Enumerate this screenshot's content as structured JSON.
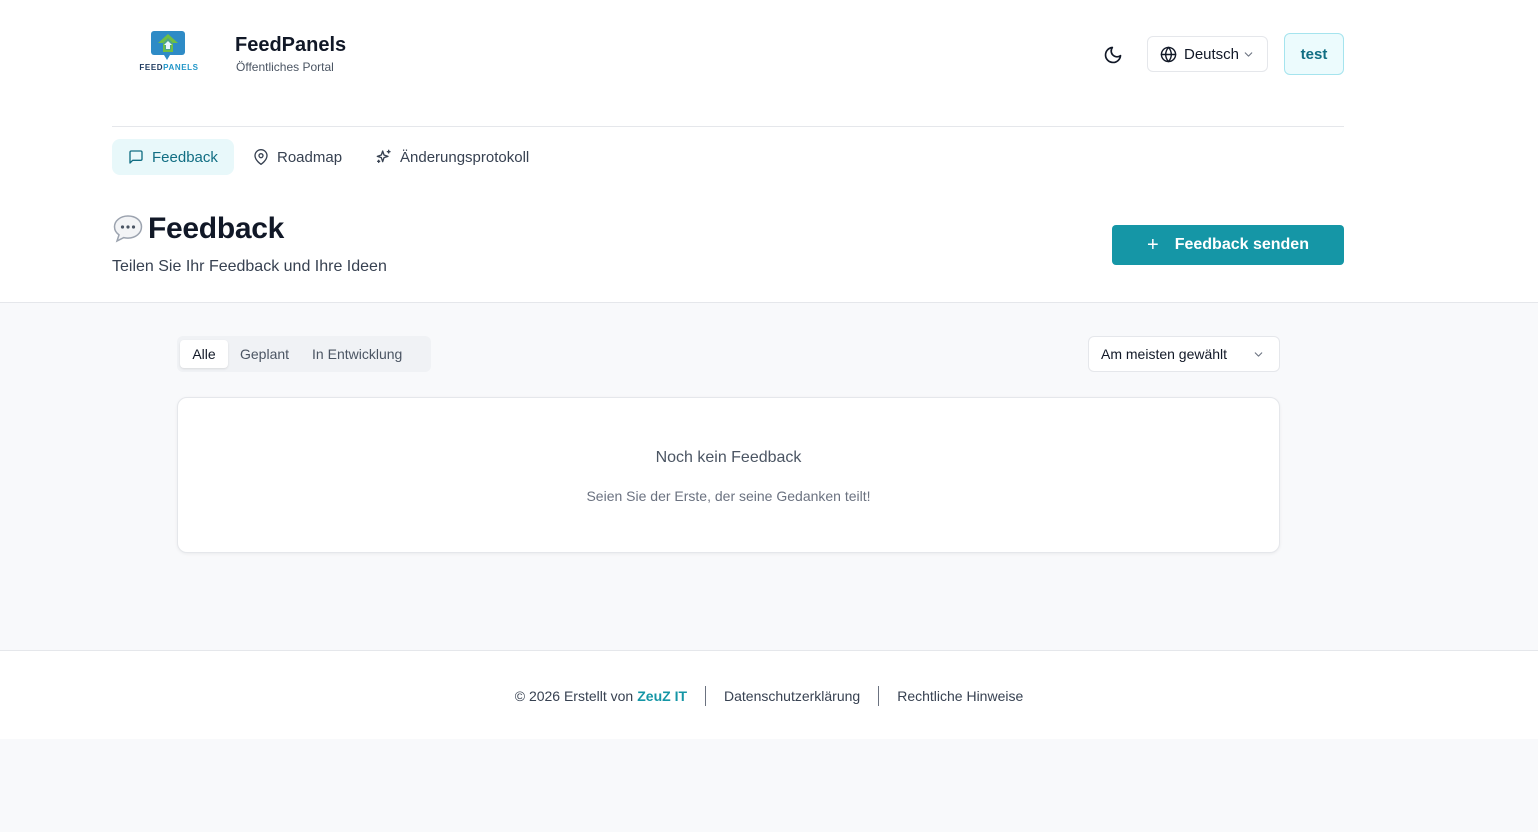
{
  "brand": {
    "logo_text_dark": "FEED",
    "logo_text_accent": "PANELS",
    "title": "FeedPanels",
    "subtitle": "Öffentliches Portal"
  },
  "header": {
    "theme_icon": "moon-icon",
    "language": "Deutsch",
    "user": "test"
  },
  "nav": {
    "items": [
      {
        "label": "Feedback",
        "icon": "message-square-icon",
        "active": true
      },
      {
        "label": "Roadmap",
        "icon": "map-pin-icon",
        "active": false
      },
      {
        "label": "Änderungsprotokoll",
        "icon": "sparkles-icon",
        "active": false
      }
    ]
  },
  "page": {
    "emoji": "speech-balloon-icon",
    "title": "Feedback",
    "subtitle": "Teilen Sie Ihr Feedback und Ihre Ideen",
    "send_button": "Feedback senden"
  },
  "filters": {
    "tabs": [
      "Alle",
      "Geplant",
      "In Entwicklung"
    ],
    "active_tab": "Alle",
    "sort": "Am meisten gewählt"
  },
  "empty_state": {
    "title": "Noch kein Feedback",
    "text": "Seien Sie der Erste, der seine Gedanken teilt!"
  },
  "footer": {
    "copyright": "© 2026 Erstellt von",
    "brand": "ZeuZ IT",
    "privacy": "Datenschutzerklärung",
    "legal": "Rechtliche Hinweise"
  },
  "colors": {
    "accent": "#1596a6",
    "accent_text": "#116e83",
    "accent_bg": "#e8f8fa"
  }
}
